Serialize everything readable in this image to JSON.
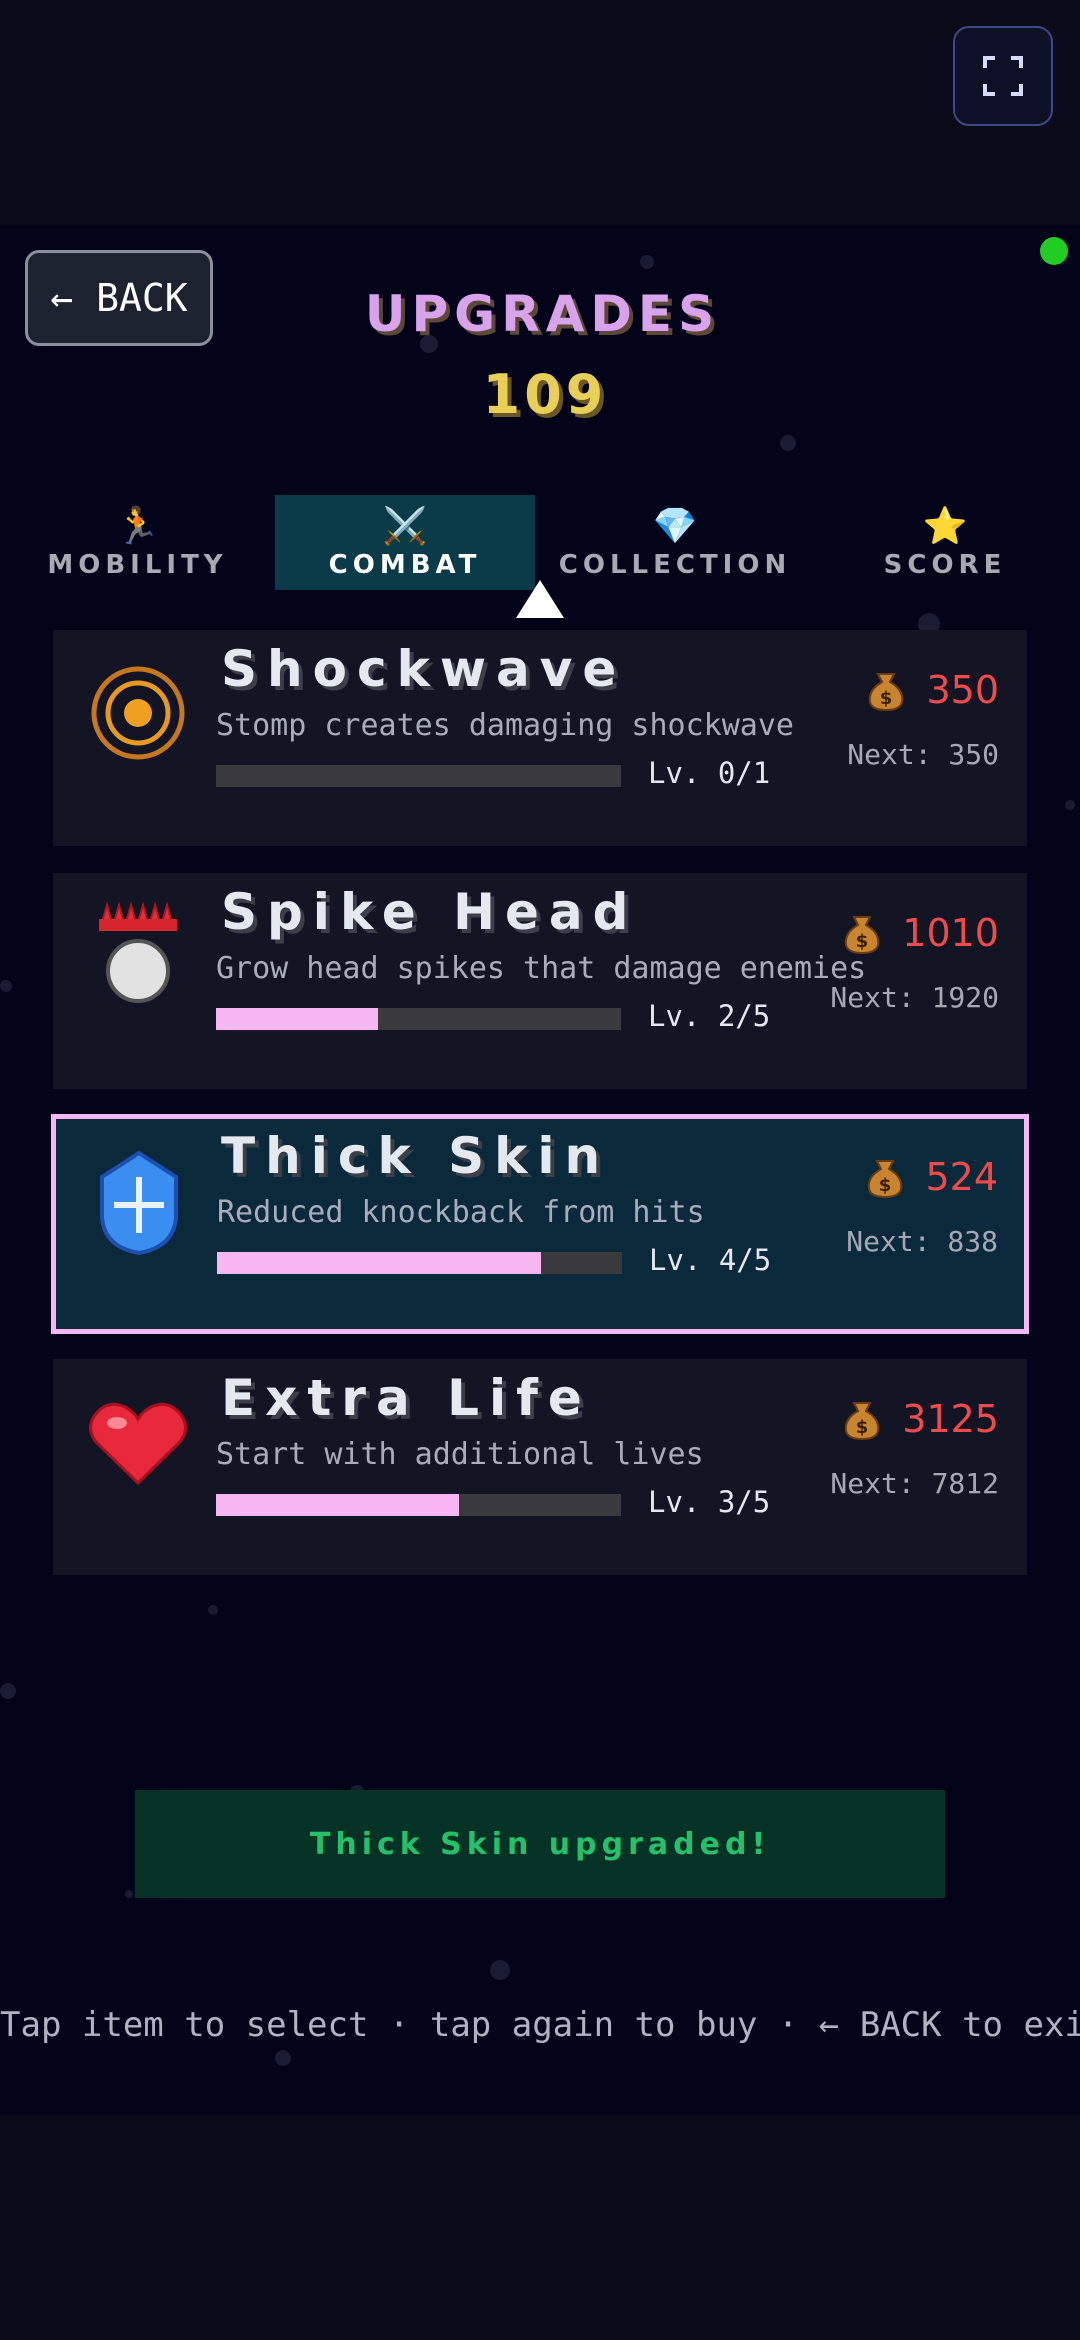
{
  "header": {
    "back_label": "← BACK",
    "title": "UPGRADES",
    "coins": "109"
  },
  "tabs": [
    {
      "icon": "🏃",
      "label": "MOBILITY",
      "active": false
    },
    {
      "icon": "⚔️",
      "label": "COMBAT",
      "active": true
    },
    {
      "icon": "💎",
      "label": "COLLECTION",
      "active": false
    },
    {
      "icon": "⭐",
      "label": "SCORE",
      "active": false
    }
  ],
  "upgrades": [
    {
      "icon": "shockwave-icon",
      "name": "Shockwave",
      "description": "Stomp creates damaging shockwave",
      "level": "Lv. 0/1",
      "progress": 0.0,
      "price": "350",
      "next": "Next: 350",
      "selected": false
    },
    {
      "icon": "spike-head-icon",
      "name": "Spike Head",
      "description": "Grow head spikes that damage enemies",
      "level": "Lv. 2/5",
      "progress": 0.4,
      "price": "1010",
      "next": "Next: 1920",
      "selected": false
    },
    {
      "icon": "shield-icon",
      "name": "Thick Skin",
      "description": "Reduced knockback from hits",
      "level": "Lv. 4/5",
      "progress": 0.8,
      "price": "524",
      "next": "Next: 838",
      "selected": true
    },
    {
      "icon": "heart-icon",
      "name": "Extra Life",
      "description": "Start with additional lives",
      "level": "Lv. 3/5",
      "progress": 0.6,
      "price": "3125",
      "next": "Next: 7812",
      "selected": false
    }
  ],
  "toast": "Thick Skin upgraded!",
  "hint": "Tap item to select · tap again to buy · ← BACK to exit",
  "colors": {
    "accent": "#f6b6f2",
    "price": "#ef4b4b",
    "coins": "#e8cf58",
    "title": "#d9a3ec",
    "toast": "#24c06a"
  }
}
